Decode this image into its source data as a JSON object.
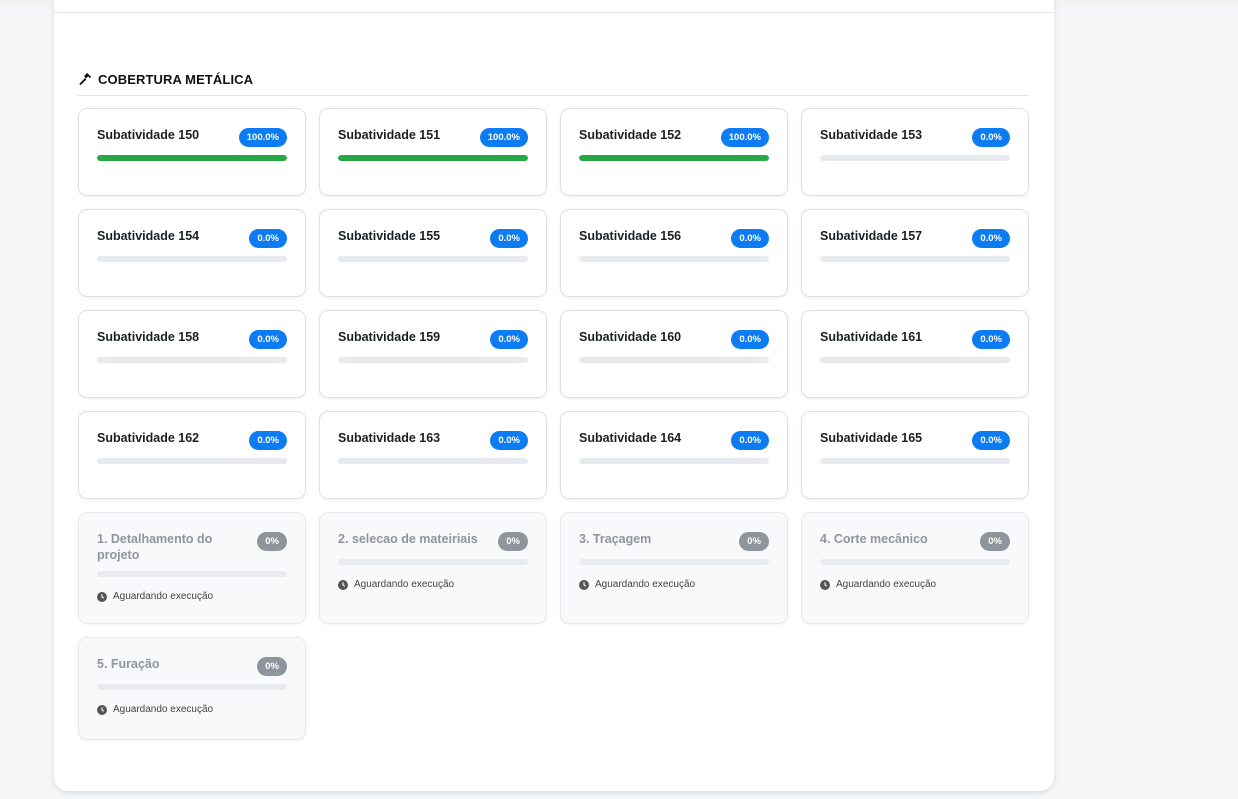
{
  "section": {
    "title": "COBERTURA METÁLICA",
    "icon": "hammer-icon"
  },
  "subactivities": [
    {
      "title": "Subatividade 150",
      "badge": "100.0%",
      "progress": 1.0
    },
    {
      "title": "Subatividade 151",
      "badge": "100.0%",
      "progress": 1.0
    },
    {
      "title": "Subatividade 152",
      "badge": "100.0%",
      "progress": 1.0
    },
    {
      "title": "Subatividade 153",
      "badge": "0.0%",
      "progress": 0
    },
    {
      "title": "Subatividade 154",
      "badge": "0.0%",
      "progress": 0
    },
    {
      "title": "Subatividade 155",
      "badge": "0.0%",
      "progress": 0
    },
    {
      "title": "Subatividade 156",
      "badge": "0.0%",
      "progress": 0
    },
    {
      "title": "Subatividade 157",
      "badge": "0.0%",
      "progress": 0
    },
    {
      "title": "Subatividade 158",
      "badge": "0.0%",
      "progress": 0
    },
    {
      "title": "Subatividade 159",
      "badge": "0.0%",
      "progress": 0
    },
    {
      "title": "Subatividade 160",
      "badge": "0.0%",
      "progress": 0
    },
    {
      "title": "Subatividade 161",
      "badge": "0.0%",
      "progress": 0
    },
    {
      "title": "Subatividade 162",
      "badge": "0.0%",
      "progress": 0
    },
    {
      "title": "Subatividade 163",
      "badge": "0.0%",
      "progress": 0
    },
    {
      "title": "Subatividade 164",
      "badge": "0.0%",
      "progress": 0
    },
    {
      "title": "Subatividade 165",
      "badge": "0.0%",
      "progress": 0
    }
  ],
  "steps": [
    {
      "title": "1. Detalhamento do projeto",
      "badge": "0%",
      "status": "Aguardando execução"
    },
    {
      "title": "2. selecao de mateiriais",
      "badge": "0%",
      "status": "Aguardando execução"
    },
    {
      "title": "3. Traçagem",
      "badge": "0%",
      "status": "Aguardando execução"
    },
    {
      "title": "4. Corte mecânico",
      "badge": "0%",
      "status": "Aguardando execução"
    },
    {
      "title": "5. Furação",
      "badge": "0%",
      "status": "Aguardando execução"
    }
  ],
  "colors": {
    "badge_active": "#0d7cf2",
    "badge_pending": "#8f959c",
    "progress_complete": "#28a745"
  }
}
